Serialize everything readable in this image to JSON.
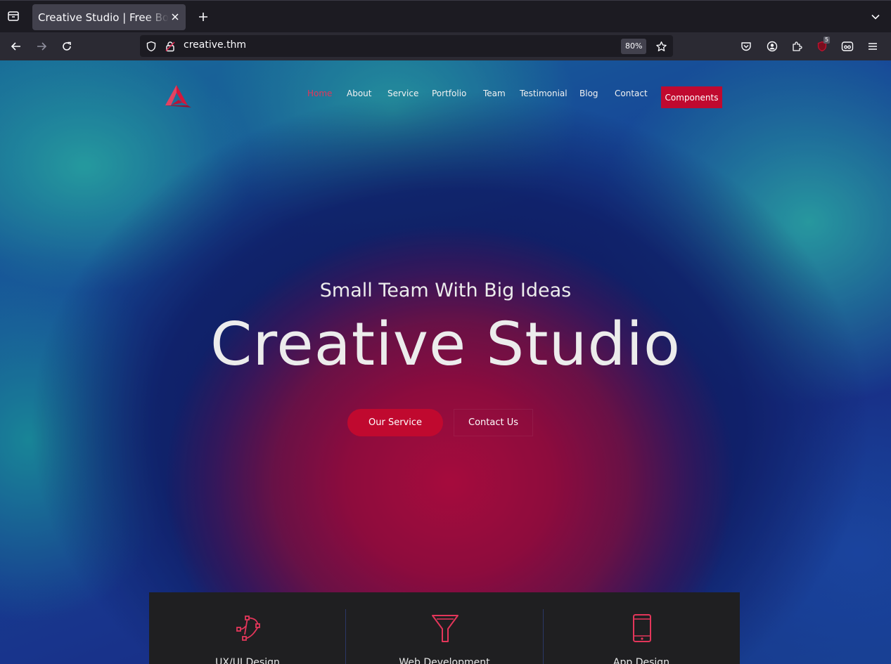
{
  "browser": {
    "tab_title": "Creative Studio | Free Bootstrap",
    "url": "creative.thm",
    "zoom": "80%",
    "extension_badge": "5"
  },
  "site": {
    "nav": {
      "home": "Home",
      "about": "About",
      "service": "Service",
      "portfolio": "Portfolio",
      "team": "Team",
      "testimonial": "Testimonial",
      "blog": "Blog",
      "contact": "Contact",
      "components": "Components"
    },
    "hero": {
      "subtitle": "Small Team With Big Ideas",
      "title": "Creative Studio",
      "primary_button": "Our Service",
      "secondary_button": "Contact Us"
    },
    "features": [
      {
        "label": "UX/UI Design",
        "icon": "vector-pen-icon"
      },
      {
        "label": "Web Development",
        "icon": "funnel-icon"
      },
      {
        "label": "App Design",
        "icon": "tablet-icon"
      }
    ],
    "colors": {
      "accent": "#c0092f",
      "accent_text": "#e3365a",
      "panel": "#1f1f21"
    }
  }
}
